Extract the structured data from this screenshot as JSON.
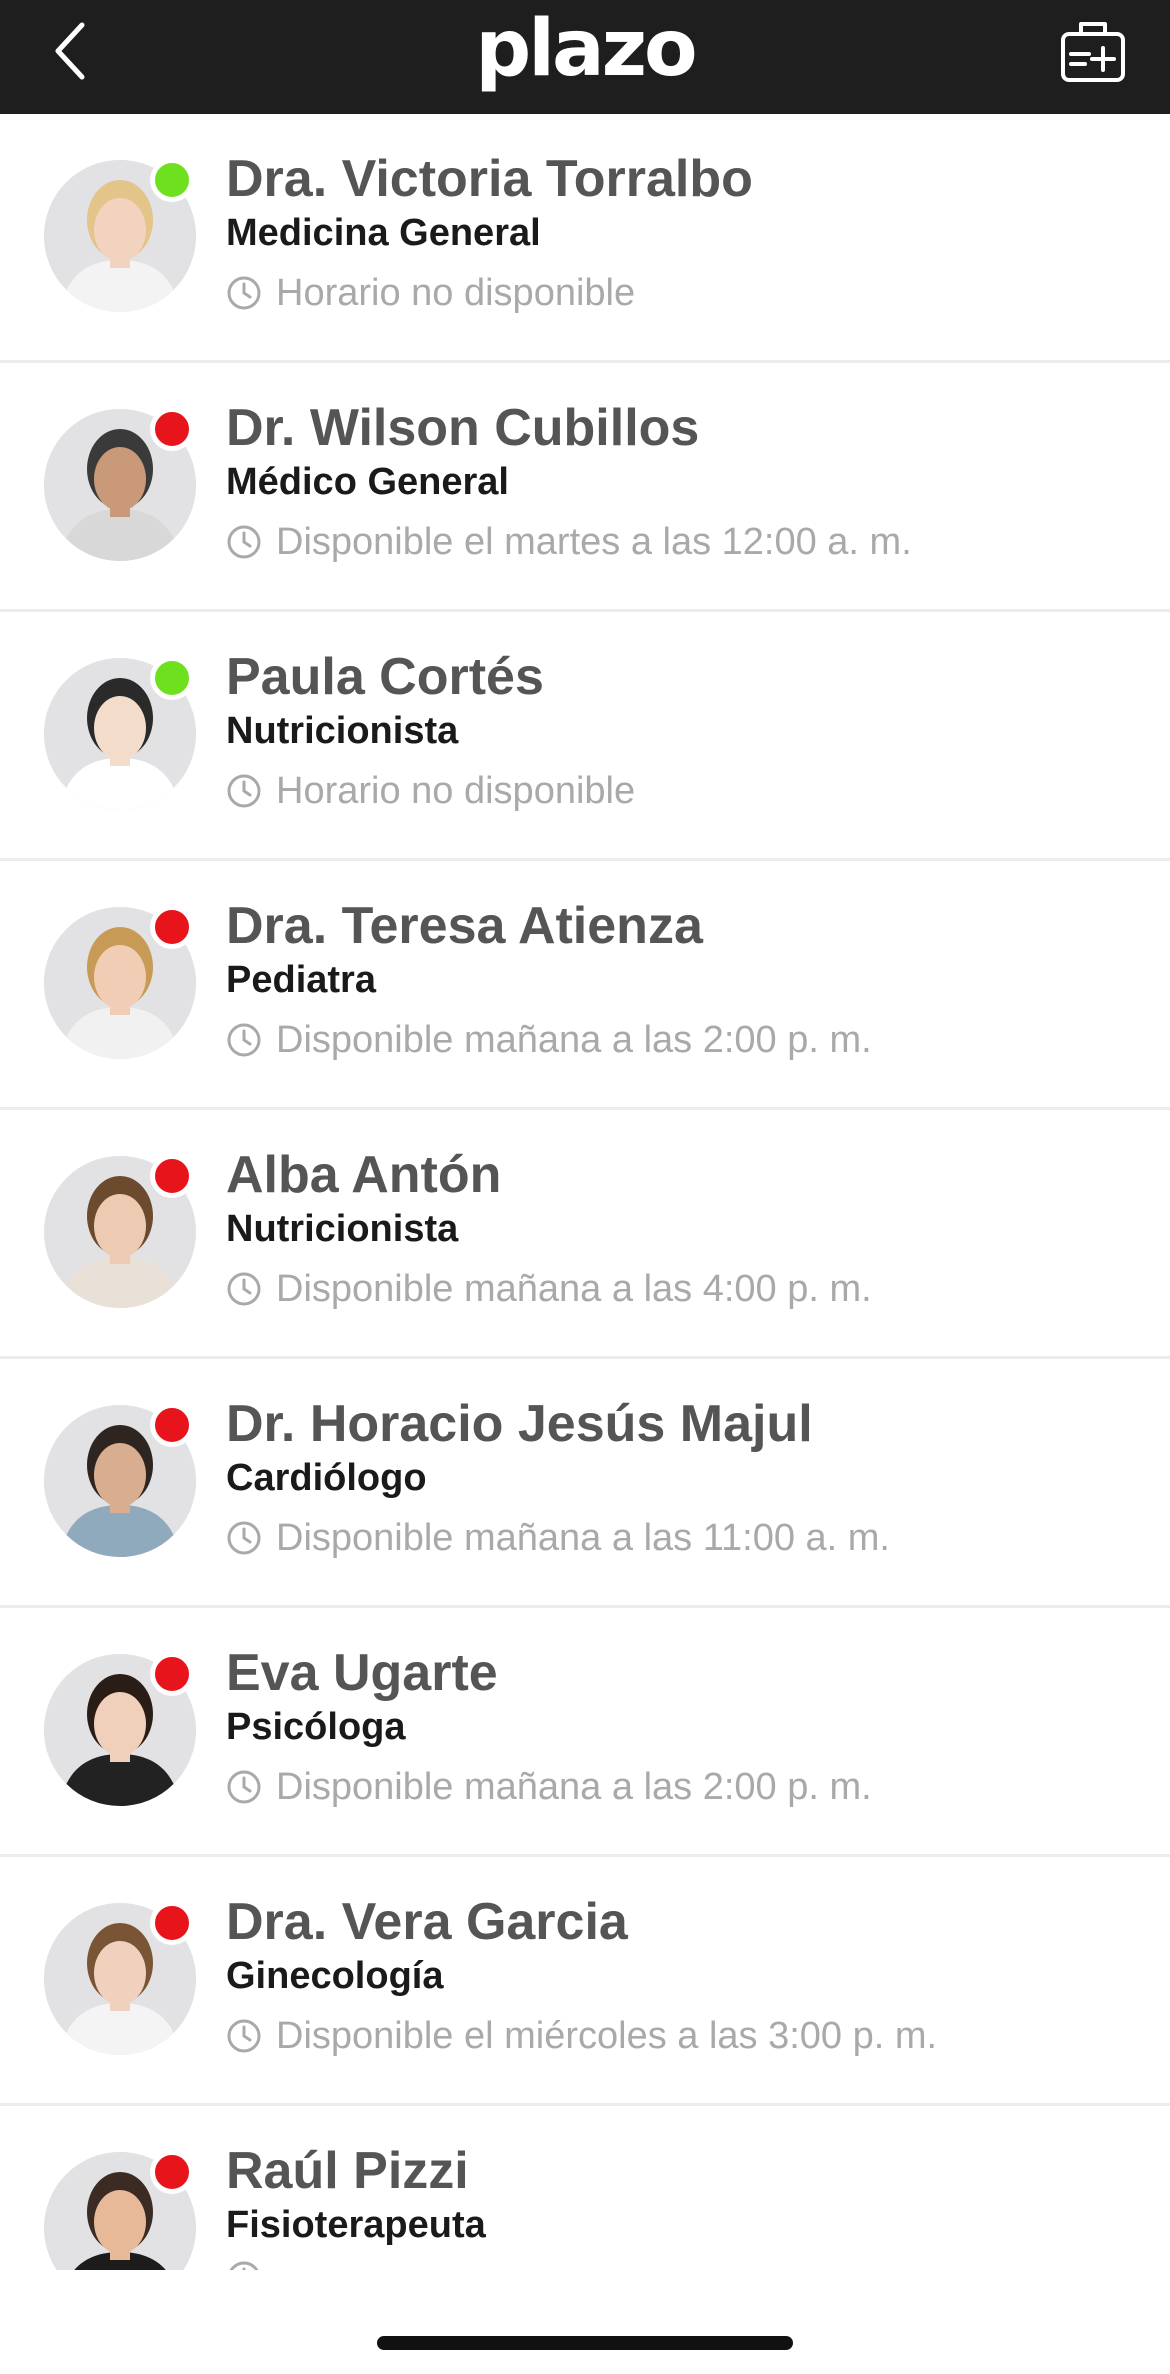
{
  "header": {
    "logo": "plazo",
    "back_icon": "chevron-left-icon",
    "add_icon": "add-appointment-icon"
  },
  "colors": {
    "header_bg": "#1e1e1e",
    "available": "#6ee01e",
    "unavailable": "#e8141b"
  },
  "doctors": [
    {
      "name": "Dra. Victoria Torralbo",
      "specialty": "Medicina General",
      "availability": "Horario no disponible",
      "status": "online"
    },
    {
      "name": "Dr. Wilson Cubillos",
      "specialty": "Médico General",
      "availability": "Disponible el martes a las 12:00 a. m.",
      "status": "offline"
    },
    {
      "name": "Paula Cortés",
      "specialty": "Nutricionista",
      "availability": "Horario no disponible",
      "status": "online"
    },
    {
      "name": "Dra. Teresa Atienza",
      "specialty": "Pediatra",
      "availability": "Disponible mañana a las 2:00 p. m.",
      "status": "offline"
    },
    {
      "name": "Alba Antón",
      "specialty": "Nutricionista",
      "availability": "Disponible mañana a las 4:00 p. m.",
      "status": "offline"
    },
    {
      "name": "Dr. Horacio Jesús Majul",
      "specialty": "Cardiólogo",
      "availability": "Disponible mañana a las 11:00 a. m.",
      "status": "offline"
    },
    {
      "name": "Eva Ugarte",
      "specialty": "Psicóloga",
      "availability": "Disponible mañana a las 2:00 p. m.",
      "status": "offline"
    },
    {
      "name": "Dra. Vera Garcia",
      "specialty": "Ginecología",
      "availability": "Disponible el miércoles a las 3:00 p. m.",
      "status": "offline"
    },
    {
      "name": "Raúl Pizzi",
      "specialty": "Fisioterapeuta",
      "availability": "",
      "status": "offline"
    }
  ]
}
